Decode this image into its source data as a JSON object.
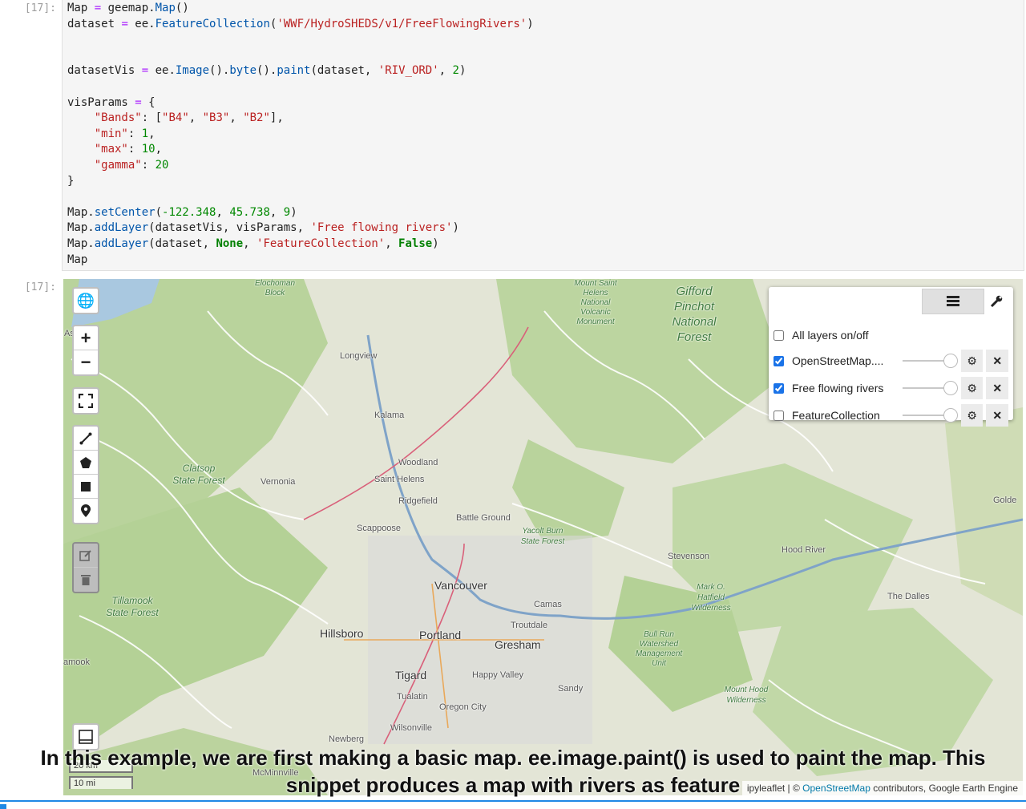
{
  "cell": {
    "in_prompt": "[17]:",
    "out_prompt": "[17]:",
    "code_lines": [
      "Map = geemap.Map()",
      "dataset = ee.FeatureCollection('WWF/HydroSHEDS/v1/FreeFlowingRivers')",
      "",
      "",
      "datasetVis = ee.Image().byte().paint(dataset, 'RIV_ORD', 2)",
      "",
      "visParams = {",
      "    \"Bands\": [\"B4\", \"B3\", \"B2\"],",
      "    \"min\": 1,",
      "    \"max\": 10,",
      "    \"gamma\": 20",
      "}",
      "",
      "Map.setCenter(-122.348, 45.738, 9)",
      "Map.addLayer(datasetVis, visParams, 'Free flowing rivers')",
      "Map.addLayer(dataset, None, 'FeatureCollection', False)",
      "Map"
    ]
  },
  "map": {
    "layer_panel": {
      "all_layers_label": "All layers on/off",
      "layers": [
        {
          "name": "OpenStreetMap....",
          "checked": true
        },
        {
          "name": "Free flowing rivers",
          "checked": true
        },
        {
          "name": "FeatureCollection",
          "checked": false
        }
      ]
    },
    "places": {
      "vancouver": "Vancouver",
      "portland": "Portland",
      "gresham": "Gresham",
      "hillsboro": "Hillsboro",
      "tigard": "Tigard",
      "happy_valley": "Happy Valley",
      "oregon_city": "Oregon City",
      "woodland": "Woodland",
      "saint_helens": "Saint Helens",
      "ridgefield": "Ridgefield",
      "battle_ground": "Battle Ground",
      "scappoose": "Scappoose",
      "vernonia": "Vernonia",
      "kalama": "Kalama",
      "longview": "Longview",
      "camas": "Camas",
      "troutdale": "Troutdale",
      "stevenson": "Stevenson",
      "hood_river": "Hood River",
      "the_dalles": "The Dalles",
      "sandy": "Sandy",
      "wilsonville": "Wilsonville",
      "newberg": "Newberg",
      "tualatin": "Tualatin",
      "mcminnville": "McMinnville",
      "goldendale": "Golde",
      "gifford": "Gifford Pinchot National Forest",
      "clatsop": "Clatsop State Forest",
      "tillamook": "Tillamook State Forest",
      "yacolt": "Yacolt Burn State Forest",
      "mount_st_helens": "Mount Saint Helens National Volcanic Monument",
      "mark_hatfield": "Mark O. Hatfield Wilderness",
      "bull_run": "Bull Run Watershed Management Unit",
      "mount_hood_wild": "Mount Hood Wilderness",
      "elochoman": "Elochoman Block",
      "astoria": "As",
      "amook": "amook"
    },
    "scale": {
      "km": "20 km",
      "mi": "10 mi"
    },
    "attribution": {
      "prefix": "ipyleaflet | © ",
      "link": "OpenStreetMap",
      "suffix": " contributors, Google Earth Engine"
    }
  },
  "caption": {
    "line1": "In this example, we are first making a basic map. ee.image.paint() is used to paint the map. This",
    "line2": "snippet produces a map with rivers as feature"
  }
}
